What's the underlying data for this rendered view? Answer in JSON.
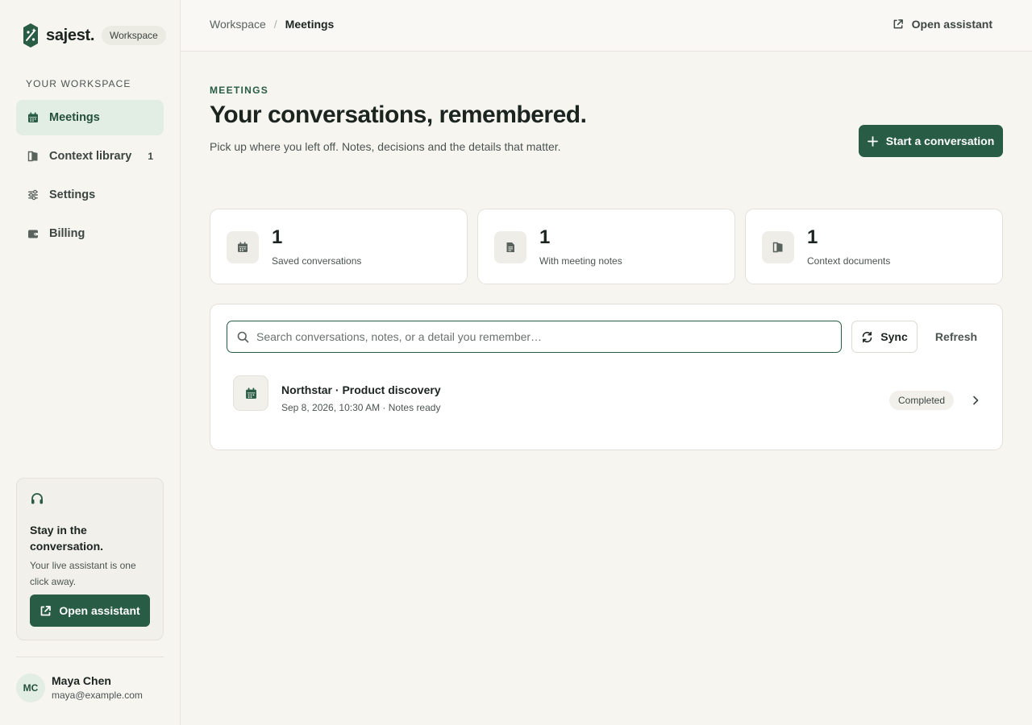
{
  "brand": {
    "name": "sajest.",
    "badge": "Workspace"
  },
  "sidebar": {
    "section_label": "YOUR WORKSPACE",
    "items": [
      {
        "label": "Meetings",
        "icon": "calendar-icon",
        "active": true
      },
      {
        "label": "Context library",
        "icon": "book-icon",
        "count": "1"
      },
      {
        "label": "Settings",
        "icon": "sliders-icon"
      },
      {
        "label": "Billing",
        "icon": "wallet-icon"
      }
    ]
  },
  "promo": {
    "title": "Stay in the conversation.",
    "text": "Your live assistant is one click away.",
    "button_label": "Open assistant"
  },
  "user": {
    "initials": "MC",
    "name": "Maya Chen",
    "email": "maya@example.com"
  },
  "topbar": {
    "breadcrumbs": [
      "Workspace",
      "Meetings"
    ],
    "action_label": "Open assistant"
  },
  "header": {
    "eyebrow": "MEETINGS",
    "title": "Your conversations, remembered.",
    "subtitle": "Pick up where you left off. Notes, decisions and the details that matter.",
    "primary_button_label": "Start a conversation"
  },
  "stats": [
    {
      "value": "1",
      "label": "Saved conversations",
      "icon": "calendar-icon"
    },
    {
      "value": "1",
      "label": "With meeting notes",
      "icon": "document-icon"
    },
    {
      "value": "1",
      "label": "Context documents",
      "icon": "book-icon"
    }
  ],
  "search": {
    "placeholder": "Search conversations, notes, or a detail you remember…",
    "value": ""
  },
  "toolbar": {
    "sync_label": "Sync",
    "refresh_label": "Refresh"
  },
  "conversations": [
    {
      "title": "Northstar · Product discovery",
      "meta": "Sep 8, 2026, 10:30 AM · Notes ready",
      "status": "Completed"
    }
  ],
  "colors": {
    "accent": "#285c45",
    "accent_soft": "#e2ede3",
    "background": "#f6f5f0"
  }
}
